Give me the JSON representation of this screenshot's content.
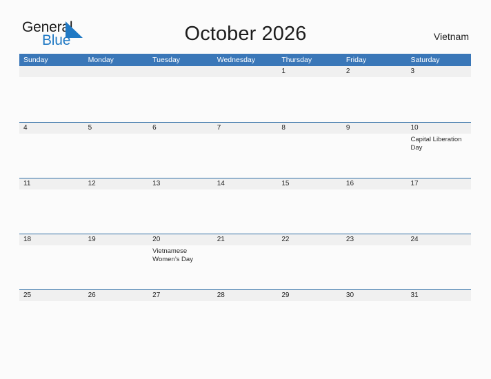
{
  "brand": {
    "name_part1": "General",
    "name_part2": "Blue",
    "triangle_color": "#2079c4"
  },
  "header": {
    "title": "October 2026",
    "country": "Vietnam"
  },
  "colors": {
    "header_blue": "#3a77b8",
    "separator_blue": "#2e6da4",
    "date_band_gray": "#f0f0f0",
    "page_background": "#fbfbfb"
  },
  "weekdays": [
    "Sunday",
    "Monday",
    "Tuesday",
    "Wednesday",
    "Thursday",
    "Friday",
    "Saturday"
  ],
  "weeks": [
    [
      {
        "date": "",
        "event": ""
      },
      {
        "date": "",
        "event": ""
      },
      {
        "date": "",
        "event": ""
      },
      {
        "date": "",
        "event": ""
      },
      {
        "date": "1",
        "event": ""
      },
      {
        "date": "2",
        "event": ""
      },
      {
        "date": "3",
        "event": ""
      }
    ],
    [
      {
        "date": "4",
        "event": ""
      },
      {
        "date": "5",
        "event": ""
      },
      {
        "date": "6",
        "event": ""
      },
      {
        "date": "7",
        "event": ""
      },
      {
        "date": "8",
        "event": ""
      },
      {
        "date": "9",
        "event": ""
      },
      {
        "date": "10",
        "event": "Capital Liberation Day"
      }
    ],
    [
      {
        "date": "11",
        "event": ""
      },
      {
        "date": "12",
        "event": ""
      },
      {
        "date": "13",
        "event": ""
      },
      {
        "date": "14",
        "event": ""
      },
      {
        "date": "15",
        "event": ""
      },
      {
        "date": "16",
        "event": ""
      },
      {
        "date": "17",
        "event": ""
      }
    ],
    [
      {
        "date": "18",
        "event": ""
      },
      {
        "date": "19",
        "event": ""
      },
      {
        "date": "20",
        "event": "Vietnamese Women’s Day"
      },
      {
        "date": "21",
        "event": ""
      },
      {
        "date": "22",
        "event": ""
      },
      {
        "date": "23",
        "event": ""
      },
      {
        "date": "24",
        "event": ""
      }
    ],
    [
      {
        "date": "25",
        "event": ""
      },
      {
        "date": "26",
        "event": ""
      },
      {
        "date": "27",
        "event": ""
      },
      {
        "date": "28",
        "event": ""
      },
      {
        "date": "29",
        "event": ""
      },
      {
        "date": "30",
        "event": ""
      },
      {
        "date": "31",
        "event": ""
      }
    ]
  ]
}
